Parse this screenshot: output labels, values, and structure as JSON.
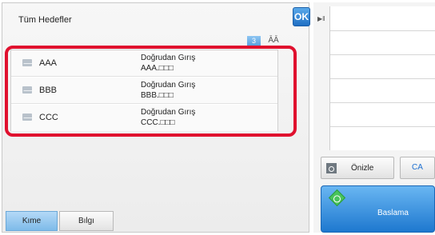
{
  "header": {
    "title": "Tüm Hedefler",
    "ok_label": "OK"
  },
  "list": {
    "count": "3",
    "sort_icon": "ĀĀ",
    "rows": [
      {
        "name": "AAA",
        "type": "Doğrudan Gırış",
        "address": "AAA.□□□"
      },
      {
        "name": "BBB",
        "type": "Doğrudan Gırış",
        "address": "BBB.□□□"
      },
      {
        "name": "CCC",
        "type": "Doğrudan Gırış",
        "address": "CCC.□□□"
      }
    ]
  },
  "tabs": {
    "to_label": "Kıme",
    "info_label": "Bılgı"
  },
  "right": {
    "preview_label": "Önizle",
    "ca_label": "CA",
    "start_label": "Baslama"
  }
}
